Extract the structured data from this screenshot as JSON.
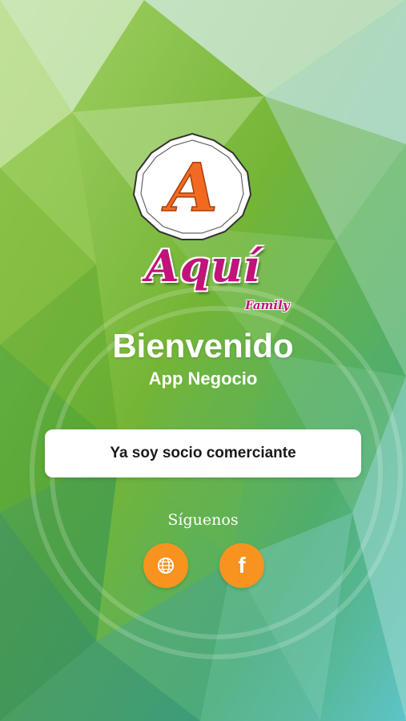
{
  "logo": {
    "letter": "A"
  },
  "brand": {
    "name": "Aquí",
    "sub": "Family"
  },
  "welcome": {
    "title": "Bienvenido",
    "subtitle": "App Negocio"
  },
  "cta": {
    "label": "Ya soy socio comerciante"
  },
  "social": {
    "heading": "Síguenos",
    "items": [
      {
        "icon": "globe-icon",
        "color": "#f7931e"
      },
      {
        "icon": "facebook-icon",
        "label": "f",
        "color": "#f7931e"
      }
    ]
  },
  "colors": {
    "brand": "#c2137a",
    "accent": "#f7931e",
    "logo_letter": "#f26a21"
  }
}
